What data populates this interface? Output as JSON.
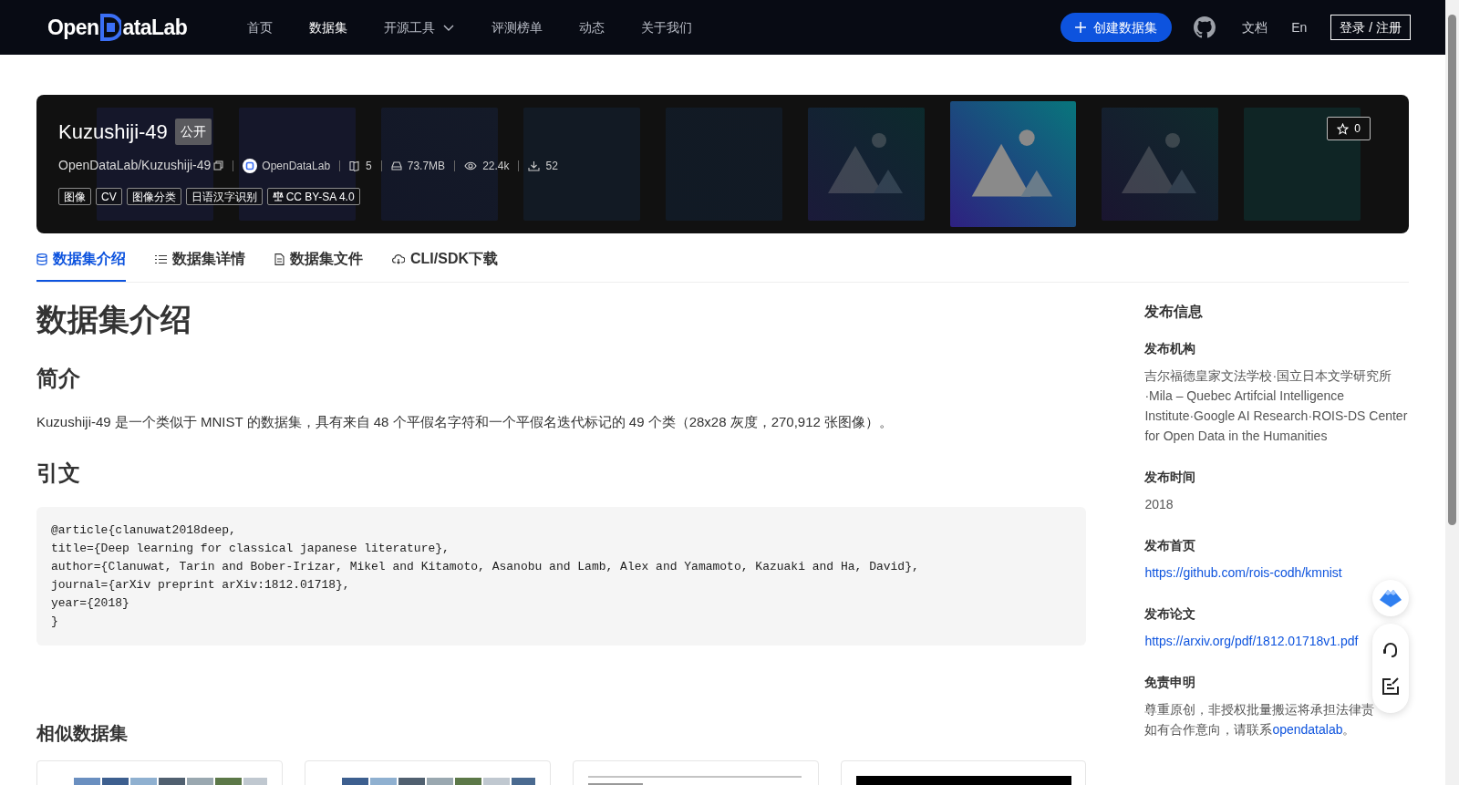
{
  "nav": {
    "logo": {
      "before": "Open",
      "after": "ataLab"
    },
    "items": [
      {
        "label": "首页",
        "selected": false,
        "dropdown": false
      },
      {
        "label": "数据集",
        "selected": true,
        "dropdown": false
      },
      {
        "label": "开源工具",
        "selected": false,
        "dropdown": true
      },
      {
        "label": "评测榜单",
        "selected": false,
        "dropdown": false
      },
      {
        "label": "动态",
        "selected": false,
        "dropdown": false
      },
      {
        "label": "关于我们",
        "selected": false,
        "dropdown": false
      }
    ],
    "create_button": "创建数据集",
    "links": [
      "文档",
      "En"
    ],
    "login_button": "登录 / 注册"
  },
  "dataset": {
    "title": "Kuzushiji-49",
    "visibility": "公开",
    "path": "OpenDataLab/Kuzushiji-49",
    "publisher": "OpenDataLab",
    "stats": [
      {
        "kind": "files",
        "value": "5"
      },
      {
        "kind": "size",
        "value": "73.7MB"
      },
      {
        "kind": "views",
        "value": "22.4k"
      },
      {
        "kind": "downloads",
        "value": "52"
      }
    ],
    "tags": [
      {
        "label": "图像",
        "kind": "tag"
      },
      {
        "label": "CV",
        "kind": "tag"
      },
      {
        "label": "图像分类",
        "kind": "tag"
      },
      {
        "label": "日语汉字识别",
        "kind": "tag"
      },
      {
        "label": "CC BY-SA 4.0",
        "kind": "license"
      }
    ],
    "stars": "0"
  },
  "tabs": [
    {
      "label": "数据集介绍",
      "kind": "intro",
      "selected": true
    },
    {
      "label": "数据集详情",
      "kind": "details",
      "selected": false
    },
    {
      "label": "数据集文件",
      "kind": "files",
      "selected": false
    },
    {
      "label": "CLI/SDK下载",
      "kind": "download",
      "selected": false
    }
  ],
  "content": {
    "title": "数据集介绍",
    "summary_heading": "简介",
    "summary": "Kuzushiji-49 是一个类似于 MNIST 的数据集，具有来自 48 个平假名字符和一个平假名迭代标记的 49 个类（28x28 灰度，270,912 张图像）。",
    "citation_heading": "引文",
    "citation": [
      "@article{clanuwat2018deep,",
      "title={Deep learning for classical japanese literature},",
      "author={Clanuwat, Tarin and Bober-Irizar, Mikel and Kitamoto, Asanobu and Lamb, Alex and Yamamoto, Kazuaki and Ha, David},",
      "journal={arXiv preprint arXiv:1812.01718},",
      "year={2018}",
      "}"
    ],
    "similar_heading": "相似数据集"
  },
  "sidebar": {
    "title": "发布信息",
    "fields": [
      {
        "label": "发布机构",
        "kind": "text",
        "value": "吉尔福德皇家文法学校·国立日本文学研究所·Mila – Quebec Artifcial Intelligence Institute·Google AI Research·ROIS-DS Center for Open Data in the Humanities"
      },
      {
        "label": "发布时间",
        "kind": "text",
        "value": "2018"
      },
      {
        "label": "发布首页",
        "kind": "link",
        "value": "https://github.com/rois-codh/kmnist"
      },
      {
        "label": "发布论文",
        "kind": "link",
        "value": "https://arxiv.org/pdf/1812.01718v1.pdf"
      },
      {
        "label": "免责申明",
        "kind": "disclaimer",
        "value": "尊重原创，非授权批量搬运将承担法律责",
        "value2": "如有合作意向，请联系",
        "link": "opendatalab",
        "end": "。"
      }
    ]
  }
}
